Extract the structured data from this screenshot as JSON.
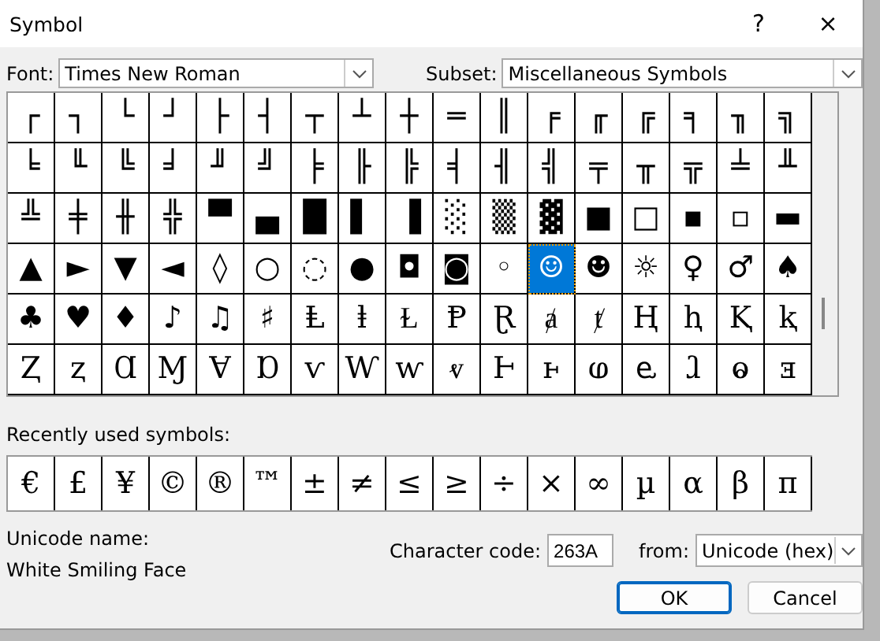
{
  "window": {
    "title": "Symbol",
    "help": "?",
    "close": "×"
  },
  "font": {
    "label": "Font:",
    "value": "Times New Roman"
  },
  "subset": {
    "label": "Subset:",
    "value": "Miscellaneous Symbols"
  },
  "grid": {
    "rows": [
      [
        {
          "char": "┌",
          "selected": false
        },
        {
          "char": "┐",
          "selected": false
        },
        {
          "char": "└",
          "selected": false
        },
        {
          "char": "┘",
          "selected": false
        },
        {
          "char": "├",
          "selected": false
        },
        {
          "char": "┤",
          "selected": false
        },
        {
          "char": "┬",
          "selected": false
        },
        {
          "char": "┴",
          "selected": false
        },
        {
          "char": "┼",
          "selected": false
        },
        {
          "char": "═",
          "selected": false
        },
        {
          "char": "║",
          "selected": false
        },
        {
          "char": "╒",
          "selected": false
        },
        {
          "char": "╓",
          "selected": false
        },
        {
          "char": "╔",
          "selected": false
        },
        {
          "char": "╕",
          "selected": false
        },
        {
          "char": "╖",
          "selected": false
        },
        {
          "char": "╗",
          "selected": false
        }
      ],
      [
        {
          "char": "╘",
          "selected": false
        },
        {
          "char": "╙",
          "selected": false
        },
        {
          "char": "╚",
          "selected": false
        },
        {
          "char": "╛",
          "selected": false
        },
        {
          "char": "╜",
          "selected": false
        },
        {
          "char": "╝",
          "selected": false
        },
        {
          "char": "╞",
          "selected": false
        },
        {
          "char": "╟",
          "selected": false
        },
        {
          "char": "╠",
          "selected": false
        },
        {
          "char": "╡",
          "selected": false
        },
        {
          "char": "╢",
          "selected": false
        },
        {
          "char": "╣",
          "selected": false
        },
        {
          "char": "╤",
          "selected": false
        },
        {
          "char": "╥",
          "selected": false
        },
        {
          "char": "╦",
          "selected": false
        },
        {
          "char": "╧",
          "selected": false
        },
        {
          "char": "╨",
          "selected": false
        }
      ],
      [
        {
          "char": "╩",
          "selected": false
        },
        {
          "char": "╪",
          "selected": false
        },
        {
          "char": "╫",
          "selected": false
        },
        {
          "char": "╬",
          "selected": false
        },
        {
          "char": "▀",
          "selected": false
        },
        {
          "char": "▄",
          "selected": false
        },
        {
          "char": "█",
          "selected": false
        },
        {
          "char": "▌",
          "selected": false
        },
        {
          "char": "▐",
          "selected": false
        },
        {
          "char": "░",
          "selected": false
        },
        {
          "char": "▒",
          "selected": false
        },
        {
          "char": "▓",
          "selected": false
        },
        {
          "char": "■",
          "selected": false
        },
        {
          "char": "□",
          "selected": false
        },
        {
          "char": "▪",
          "selected": false
        },
        {
          "char": "▫",
          "selected": false
        },
        {
          "char": "▬",
          "selected": false
        }
      ],
      [
        {
          "char": "▲",
          "selected": false
        },
        {
          "char": "►",
          "selected": false
        },
        {
          "char": "▼",
          "selected": false
        },
        {
          "char": "◄",
          "selected": false
        },
        {
          "char": "◊",
          "selected": false
        },
        {
          "char": "○",
          "selected": false
        },
        {
          "char": "◌",
          "selected": false
        },
        {
          "char": "●",
          "selected": false
        },
        {
          "char": "◘",
          "selected": false
        },
        {
          "char": "◙",
          "selected": false
        },
        {
          "char": "◦",
          "selected": false
        },
        {
          "char": "☺",
          "selected": true
        },
        {
          "char": "☻",
          "selected": false
        },
        {
          "char": "☼",
          "selected": false
        },
        {
          "char": "♀",
          "selected": false
        },
        {
          "char": "♂",
          "selected": false
        },
        {
          "char": "♠",
          "selected": false
        }
      ],
      [
        {
          "char": "♣",
          "selected": false
        },
        {
          "char": "♥",
          "selected": false
        },
        {
          "char": "♦",
          "selected": false
        },
        {
          "char": "♪",
          "selected": false
        },
        {
          "char": "♫",
          "selected": false
        },
        {
          "char": "♯",
          "selected": false
        },
        {
          "char": "Ⱡ",
          "selected": false
        },
        {
          "char": "ⱡ",
          "selected": false
        },
        {
          "char": "Ɫ",
          "selected": false
        },
        {
          "char": "Ᵽ",
          "selected": false
        },
        {
          "char": "Ɽ",
          "selected": false
        },
        {
          "char": "ⱥ",
          "selected": false
        },
        {
          "char": "ⱦ",
          "selected": false
        },
        {
          "char": "Ⱨ",
          "selected": false
        },
        {
          "char": "ⱨ",
          "selected": false
        },
        {
          "char": "Ⱪ",
          "selected": false
        },
        {
          "char": "ⱪ",
          "selected": false
        }
      ],
      [
        {
          "char": "Ⱬ",
          "selected": false
        },
        {
          "char": "ⱬ",
          "selected": false
        },
        {
          "char": "Ɑ",
          "selected": false
        },
        {
          "char": "Ɱ",
          "selected": false
        },
        {
          "char": "Ɐ",
          "selected": false
        },
        {
          "char": "Ɒ",
          "selected": false
        },
        {
          "char": "ⱱ",
          "selected": false
        },
        {
          "char": "Ⱳ",
          "selected": false
        },
        {
          "char": "ⱳ",
          "selected": false
        },
        {
          "char": "ⱴ",
          "selected": false
        },
        {
          "char": "Ⱶ",
          "selected": false
        },
        {
          "char": "ⱶ",
          "selected": false
        },
        {
          "char": "ⱷ",
          "selected": false
        },
        {
          "char": "ⱸ",
          "selected": false
        },
        {
          "char": "ⱹ",
          "selected": false
        },
        {
          "char": "ⱺ",
          "selected": false
        },
        {
          "char": "ⱻ",
          "selected": false
        }
      ]
    ]
  },
  "recent": {
    "label": "Recently used symbols:",
    "symbols": [
      "€",
      "£",
      "¥",
      "©",
      "®",
      "™",
      "±",
      "≠",
      "≤",
      "≥",
      "÷",
      "×",
      "∞",
      "µ",
      "α",
      "β",
      "π"
    ]
  },
  "unicode_name": {
    "label": "Unicode name:",
    "value": "White Smiling Face"
  },
  "character_code": {
    "label": "Character code:",
    "value": "263A"
  },
  "from": {
    "label": "from:",
    "value": "Unicode (hex)"
  },
  "buttons": [
    {
      "label": "OK",
      "default": true
    },
    {
      "label": "Cancel",
      "default": false
    }
  ]
}
